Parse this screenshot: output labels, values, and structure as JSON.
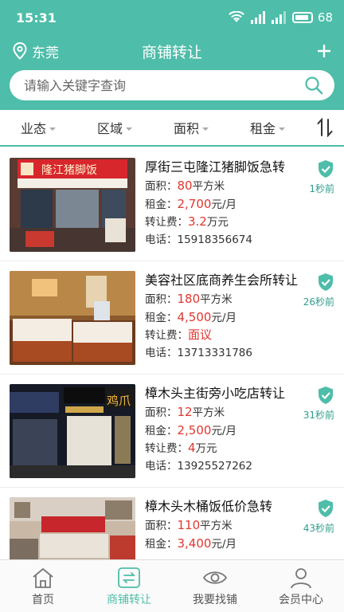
{
  "status_bar": {
    "time": "15:31",
    "battery": "68"
  },
  "header": {
    "location": "东莞",
    "title": "商铺转让"
  },
  "search": {
    "placeholder": "请输入关键字查询"
  },
  "filters": [
    "业态",
    "区域",
    "面积",
    "租金"
  ],
  "labels": {
    "area": "面积：",
    "rent": "租金：",
    "fee": "转让费：",
    "phone": "电话："
  },
  "listings": [
    {
      "title": "厚街三屯隆江猪脚饭急转",
      "area": "80",
      "area_unit": "平方米",
      "rent": "2,700",
      "rent_unit": "元/月",
      "fee": "3.2",
      "fee_unit": "万元",
      "phone": "15918356674",
      "time": "1秒前"
    },
    {
      "title": "美容社区底商养生会所转让",
      "area": "180",
      "area_unit": "平方米",
      "rent": "4,500",
      "rent_unit": "元/月",
      "fee": "面议",
      "fee_unit": "",
      "phone": "13713331786",
      "time": "26秒前"
    },
    {
      "title": "樟木头主街旁小吃店转让",
      "area": "12",
      "area_unit": "平方米",
      "rent": "2,500",
      "rent_unit": "元/月",
      "fee": "4",
      "fee_unit": "万元",
      "phone": "13925527262",
      "time": "31秒前"
    },
    {
      "title": "樟木头木桶饭低价急转",
      "area": "110",
      "area_unit": "平方米",
      "rent": "3,400",
      "rent_unit": "元/月",
      "fee": "",
      "fee_unit": "",
      "phone": "",
      "time": "43秒前"
    }
  ],
  "nav": [
    {
      "label": "首页",
      "icon": "home-icon"
    },
    {
      "label": "商铺转让",
      "icon": "transfer-icon"
    },
    {
      "label": "我要找铺",
      "icon": "eye-icon"
    },
    {
      "label": "会员中心",
      "icon": "user-icon"
    }
  ],
  "colors": {
    "accent": "#4ebda9",
    "price": "#e0372f",
    "time": "#2f9e8c"
  }
}
